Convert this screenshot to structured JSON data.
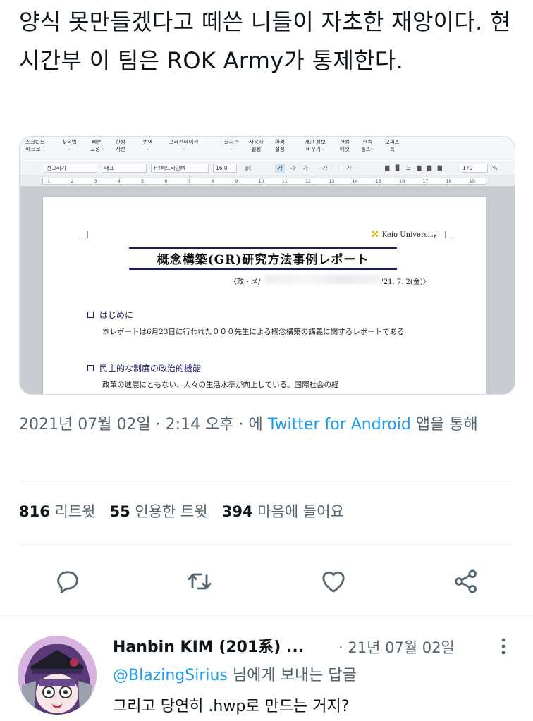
{
  "tweet": {
    "text": "양식 못만들겠다고 떼쓴 니들이 자초한 재앙이다. 현시간부 이 팀은 ROK Army가 통제한다."
  },
  "screenshot": {
    "toolbar": [
      "스크립트\n매크로 -",
      "찾음법\n-",
      "빠른\n교정 -",
      "한컴\n사전",
      "번역\n-",
      "프레젠테이션\n-",
      "글자판\n-",
      "사용자\n설정",
      "환경\n설정",
      "개인 정보\n바꾸기 -",
      "한컴\n애셋",
      "한컴\n툴즈 -",
      "오피스\n톡"
    ],
    "format": {
      "style": "선그리기",
      "para_style": "대표",
      "font": "HY헤드라인M",
      "size": "16.0",
      "size_unit": "pt",
      "zoom": "170",
      "zoom_unit": "%"
    },
    "ruler": [
      "1",
      "2",
      "3",
      "4",
      "5",
      "6",
      "7",
      "8",
      "9",
      "10",
      "11",
      "12",
      "13",
      "14",
      "15",
      "16",
      "17",
      "18",
      "19"
    ],
    "doc": {
      "university": "Keio University",
      "title": "概念構築(GR)研究方法事例レポート",
      "meta_prefix": "〈政・メ/",
      "date": "'21. 7. 2(金)〉",
      "section1": "はじめに",
      "para1": "本レポートは6月23日に行われた０００先生による概念構築の講義に関するレポートである",
      "section2": "民主的な制度の政治的機能",
      "para2": "政革の進展にともない、人々の生活水準が向上している。国際社会の経"
    }
  },
  "meta": {
    "timestamp": "2021년 07월 02일 · 2:14 오후 · 에 ",
    "source": "Twitter for Android",
    "suffix": " 앱을 통해"
  },
  "stats": {
    "retweets_count": "816",
    "retweets_label": "리트윗",
    "quotes_count": "55",
    "quotes_label": "인용한 트윗",
    "likes_count": "394",
    "likes_label": "마음에 들어요"
  },
  "actions": [
    "reply-icon",
    "retweet-icon",
    "like-icon",
    "share-icon"
  ],
  "reply": {
    "name": "Hanbin KIM (201系) ...",
    "date": "· 21년 07월 02일",
    "to_handle": "@BlazingSirius",
    "to_suffix": " 님에게 보내는 답글",
    "text": "그리고 당연히 .hwp로 만드는 거지?"
  },
  "colors": {
    "accent": "#1d9bf0",
    "secondary_text": "#536471",
    "primary_text": "#0f1419",
    "divider": "#eff3f4"
  }
}
